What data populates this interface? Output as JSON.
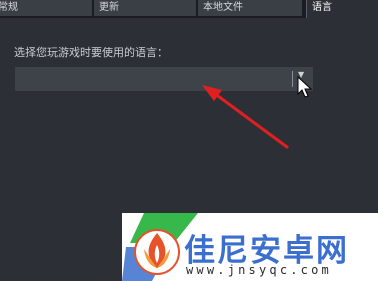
{
  "tabs": [
    {
      "label": "常规",
      "active": false
    },
    {
      "label": "更新",
      "active": false
    },
    {
      "label": "本地文件",
      "active": false
    },
    {
      "label": "语言",
      "active": true
    }
  ],
  "language": {
    "prompt": "选择您玩游戏时要使用的语言：",
    "selected_value": "",
    "caret_icon": "chevron-down-icon"
  },
  "watermark": {
    "title": "佳尼安卓网",
    "url": "www.jnsyqc.com"
  },
  "colors": {
    "background": "#2c3036",
    "dropdown": "#3e434a",
    "annotation_arrow": "#e02020",
    "watermark_text": "#3b6fcf"
  }
}
